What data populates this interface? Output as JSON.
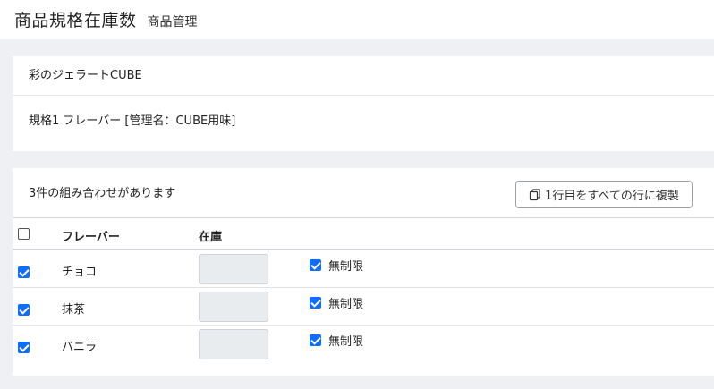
{
  "header": {
    "title": "商品規格在庫数",
    "subtitle": "商品管理"
  },
  "product": {
    "name": "彩のジェラートCUBE",
    "spec_line": "規格1 フレーバー [管理名：CUBE用味]"
  },
  "stock": {
    "combo_count": "3件の組み合わせがあります",
    "copy_button_label": "1行目をすべての行に複製",
    "copy_icon": "copy-icon",
    "columns": {
      "flavor": "フレーバー",
      "stock": "在庫"
    },
    "select_all_checked": false,
    "rows": [
      {
        "flavor": "チョコ",
        "checked": true,
        "stock_value": "",
        "unlimited_checked": true,
        "unlimited_label": "無制限"
      },
      {
        "flavor": "抹茶",
        "checked": true,
        "stock_value": "",
        "unlimited_checked": true,
        "unlimited_label": "無制限"
      },
      {
        "flavor": "バニラ",
        "checked": true,
        "stock_value": "",
        "unlimited_checked": true,
        "unlimited_label": "無制限"
      }
    ]
  },
  "colors": {
    "accent": "#0d6efd",
    "page_bg": "#eef0f4",
    "disabled_input": "#e9ecef"
  }
}
